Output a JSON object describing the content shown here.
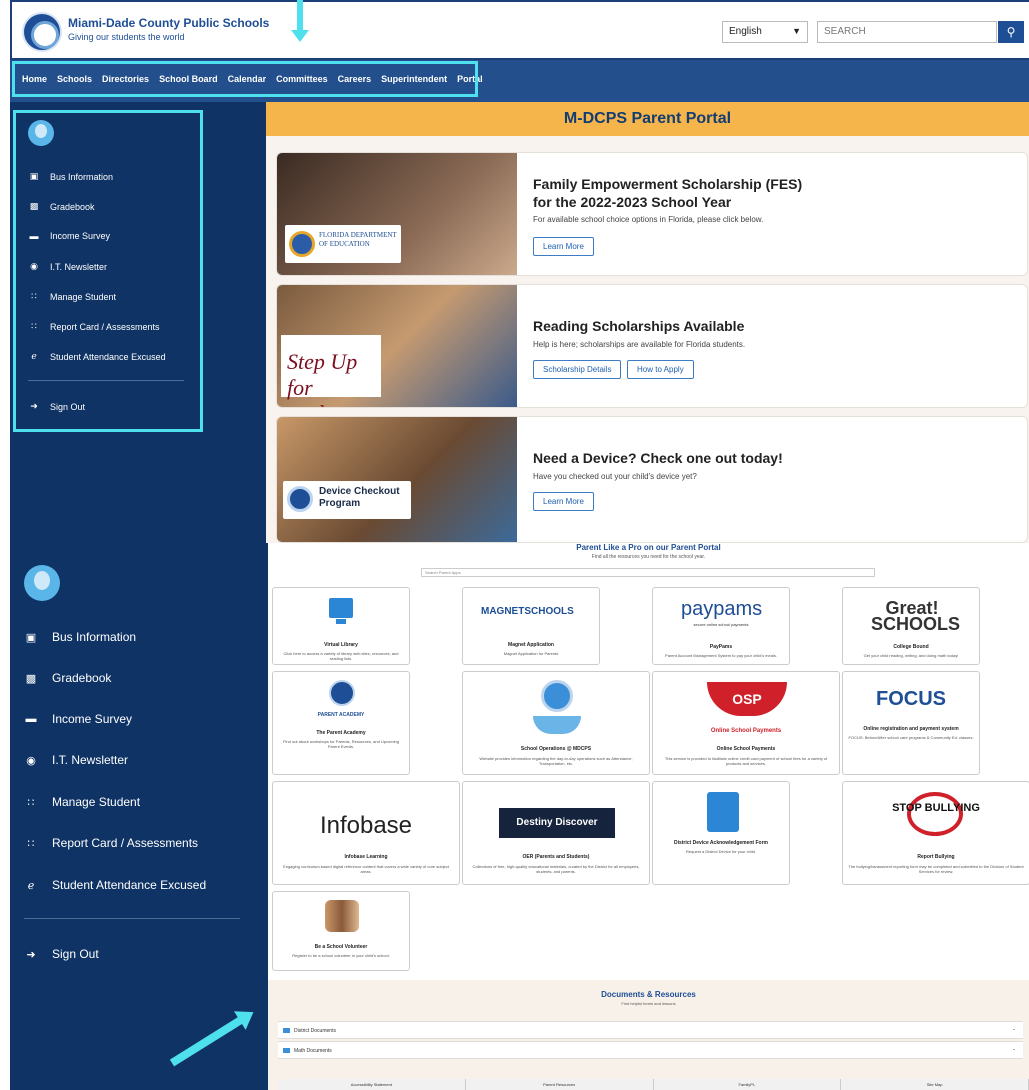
{
  "header": {
    "brand_name": "Miami-Dade County Public Schools",
    "brand_tagline": "Giving our students the world",
    "language": "English",
    "search_placeholder": "SEARCH"
  },
  "nav": [
    "Home",
    "Schools",
    "Directories",
    "School Board",
    "Calendar",
    "Committees",
    "Careers",
    "Superintendent",
    "Portal"
  ],
  "sidebar": {
    "items": [
      {
        "label": "Bus Information",
        "icon": "bus-icon"
      },
      {
        "label": "Gradebook",
        "icon": "gradebook-icon"
      },
      {
        "label": "Income Survey",
        "icon": "money-icon"
      },
      {
        "label": "I.T. Newsletter",
        "icon": "newsletter-icon"
      },
      {
        "label": "Manage Student",
        "icon": "family-icon"
      },
      {
        "label": "Report Card / Assessments",
        "icon": "family-icon"
      },
      {
        "label": "Student Attendance Excused",
        "icon": "person-icon"
      }
    ],
    "sign_out": "Sign Out"
  },
  "portal_title": "M-DCPS Parent Portal",
  "cards": [
    {
      "title": "Family Empowerment Scholarship (FES)\nfor the 2022-2023 School Year",
      "text": "For available school choice options in Florida, please click below.",
      "buttons": [
        "Learn More"
      ],
      "image_text": "FLORIDA DEPARTMENT OF EDUCATION"
    },
    {
      "title": "Reading Scholarships Available",
      "text": "Help is here; scholarships are available for Florida students.",
      "buttons": [
        "Scholarship Details",
        "How to Apply"
      ],
      "image_text": "Step Up for students"
    },
    {
      "title": "Need a Device? Check one out today!",
      "text": "Have you checked out your child's device yet?",
      "buttons": [
        "Learn More"
      ],
      "image_text": "Device Checkout Program"
    }
  ],
  "lower": {
    "title": "Parent Like a Pro on our Parent Portal",
    "subtitle": "Find all the resources you need for the school year.",
    "search_placeholder": "Search Parent Apps",
    "tiles": [
      {
        "title": "Virtual Library",
        "desc": "Click here to access a variety of library web sites, resources, and reading lists."
      },
      {
        "title": "Magnet Application",
        "desc": "Magnet Application for Parents",
        "logo": "MAGNETSCHOOLS"
      },
      {
        "title": "PayPams",
        "desc": "Parent Account Management System to pay your child's meals.",
        "logo": "paypams",
        "logo_sub": "secure online school payments"
      },
      {
        "title": "College Bound",
        "desc": "Get your child reading, writing, and doing math today!",
        "logo": "Great! SCHOOLS"
      },
      {
        "title": "The Parent Academy",
        "desc": "Find out about workshops for Parents, Resources, and Upcoming Parent Events.",
        "logo": "PARENT ACADEMY"
      },
      {
        "title": "School Operations @ MDCPS",
        "desc": "Website provides information regarding the day-to-day operations such as Attendance, Transportation, etc."
      },
      {
        "title": "Online School Payments",
        "desc": "This service is provided to facilitate online credit card payment of school fees for a variety of products and services.",
        "logo": "OSP",
        "logo_sub": "Online School Payments"
      },
      {
        "title": "Online registration and payment system",
        "desc": "FOCUS: Before/After school care programs & Community Ed. classes.",
        "logo": "FOCUS"
      },
      {
        "title": "Infobase Learning",
        "desc": "Engaging curriculum-based digital reference content that covers a wide variety of core subject areas.",
        "logo": "Infobase"
      },
      {
        "title": "OER (Parents and Students)",
        "desc": "Collections of free, high-quality educational materials, curated by the District for all employees, students, and parents.",
        "logo": "Destiny Discover"
      },
      {
        "title": "District Device Acknowledgement Form",
        "desc": "Request a District Device for your child."
      },
      {
        "title": "Report Bullying",
        "desc": "The bullying/harassment reporting form may be completed and submitted to the Division of Student Services for review.",
        "logo": "STOP BULLYING"
      },
      {
        "title": "Be a School Volunteer",
        "desc": "Register to be a school volunteer in your child's school."
      }
    ],
    "docs_title": "Documents & Resources",
    "docs_subtitle": "Find helpful forms and lessons",
    "docs": [
      "District Documents",
      "Math Documents"
    ],
    "footer": [
      "Accessibility Statement",
      "Parent Resources",
      "FamilyPL",
      "Site Map"
    ]
  },
  "colors": {
    "navy": "#0f3364",
    "nav_blue": "#234f8c",
    "accent_orange": "#f6b54a",
    "highlight": "#4ee0ec"
  }
}
